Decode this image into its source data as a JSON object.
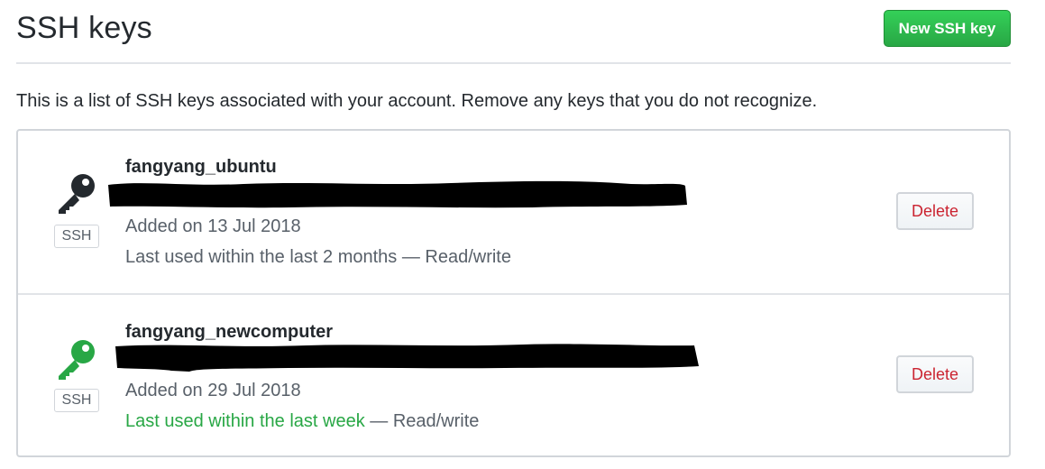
{
  "header": {
    "title": "SSH keys",
    "new_key_label": "New SSH key"
  },
  "intro_text": "This is a list of SSH keys associated with your account. Remove any keys that you do not recognize.",
  "keys": [
    {
      "title": "fangyang_ubuntu",
      "badge": "SSH",
      "added": "Added on 13 Jul 2018",
      "last_used": "Last used within the last 2 months",
      "access": " — Read/write",
      "delete_label": "Delete",
      "icon_color": "#24292e"
    },
    {
      "title": "fangyang_newcomputer",
      "badge": "SSH",
      "added": "Added on 29 Jul 2018",
      "last_used": "Last used within the last week",
      "access": " — Read/write",
      "delete_label": "Delete",
      "icon_color": "#28a745"
    }
  ],
  "colors": {
    "primary_button": "#28a745",
    "danger_text": "#cb2431",
    "recent_text": "#28a745",
    "border": "#d1d5da"
  }
}
